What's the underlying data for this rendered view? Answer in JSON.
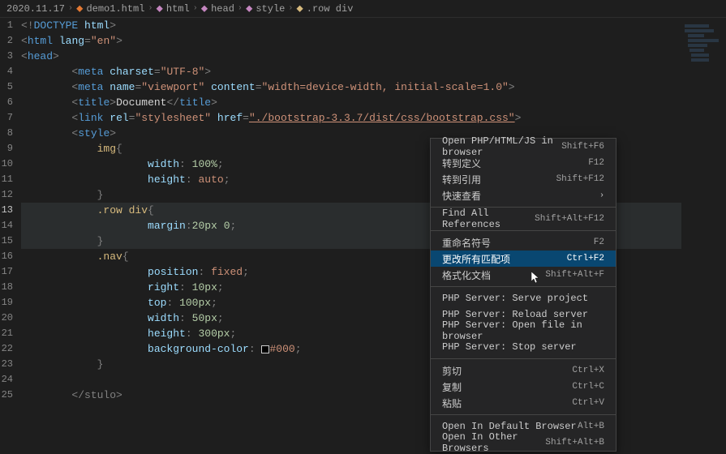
{
  "breadcrumb": {
    "root": "2020.11.17",
    "file": "demo1.html",
    "items": [
      "html",
      "head",
      "style",
      ".row div"
    ]
  },
  "lines": {
    "1": {
      "indent": 0,
      "type": "doctype",
      "pre": "<!",
      "tag": "DOCTYPE",
      "attr": " html",
      "post": ">"
    },
    "2": {
      "indent": 0,
      "type": "openattr",
      "tag": "html",
      "attrs": [
        {
          "n": "lang",
          "v": "\"en\""
        }
      ]
    },
    "3": {
      "indent": 0,
      "type": "open",
      "tag": "head"
    },
    "4": {
      "indent": 2,
      "type": "openattr",
      "tag": "meta",
      "attrs": [
        {
          "n": "charset",
          "v": "\"UTF-8\""
        }
      ]
    },
    "5": {
      "indent": 2,
      "type": "openattr",
      "tag": "meta",
      "attrs": [
        {
          "n": "name",
          "v": "\"viewport\""
        },
        {
          "n": "content",
          "v": "\"width=device-width, initial-scale=1.0\""
        }
      ]
    },
    "6": {
      "indent": 2,
      "type": "wrap",
      "tag": "title",
      "text": "Document"
    },
    "7": {
      "indent": 2,
      "type": "openattr",
      "tag": "link",
      "attrs": [
        {
          "n": "rel",
          "v": "\"stylesheet\""
        },
        {
          "n": "href",
          "v": "\"./bootstrap-3.3.7/dist/css/bootstrap.css\"",
          "u": true
        }
      ]
    },
    "8": {
      "indent": 2,
      "type": "open",
      "tag": "style"
    },
    "9": {
      "indent": 3,
      "type": "css-sel",
      "sel": "img",
      "brace": "{"
    },
    "10": {
      "indent": 5,
      "type": "css-prop",
      "prop": "width",
      "val": "100%"
    },
    "11": {
      "indent": 5,
      "type": "css-prop",
      "prop": "height",
      "val": "auto"
    },
    "12": {
      "indent": 3,
      "type": "css-close"
    },
    "13": {
      "indent": 3,
      "type": "css-sel",
      "sel": ".row div",
      "brace": "{",
      "hl": true
    },
    "14": {
      "indent": 5,
      "type": "css-prop",
      "prop": "margin",
      "val": "20px 0",
      "nospace": true,
      "hl": true
    },
    "15": {
      "indent": 3,
      "type": "css-close",
      "hl": true
    },
    "16": {
      "indent": 3,
      "type": "css-sel",
      "sel": ".nav",
      "brace": "{"
    },
    "17": {
      "indent": 5,
      "type": "css-prop",
      "prop": "position",
      "val": "fixed"
    },
    "18": {
      "indent": 5,
      "type": "css-prop",
      "prop": "right",
      "val": "10px"
    },
    "19": {
      "indent": 5,
      "type": "css-prop",
      "prop": "top",
      "val": "100px"
    },
    "20": {
      "indent": 5,
      "type": "css-prop",
      "prop": "width",
      "val": "50px"
    },
    "21": {
      "indent": 5,
      "type": "css-prop",
      "prop": "height",
      "val": "300px"
    },
    "22": {
      "indent": 5,
      "type": "css-prop",
      "prop": "background-color",
      "val": "#000",
      "swatch": true
    },
    "23": {
      "indent": 3,
      "type": "css-close"
    },
    "24": {
      "indent": 0,
      "type": "blank"
    },
    "25": {
      "indent": 2,
      "type": "close-partial",
      "text": "</stulo>"
    }
  },
  "menu": [
    {
      "type": "item",
      "label": "Open PHP/HTML/JS in browser",
      "shortcut": "Shift+F6"
    },
    {
      "type": "item",
      "label": "转到定义",
      "shortcut": "F12"
    },
    {
      "type": "item",
      "label": "转到引用",
      "shortcut": "Shift+F12"
    },
    {
      "type": "item",
      "label": "快速查看",
      "shortcut": "",
      "sub": true
    },
    {
      "type": "sep"
    },
    {
      "type": "item",
      "label": "Find All References",
      "shortcut": "Shift+Alt+F12"
    },
    {
      "type": "sep"
    },
    {
      "type": "item",
      "label": "重命名符号",
      "shortcut": "F2"
    },
    {
      "type": "item",
      "label": "更改所有匹配项",
      "shortcut": "Ctrl+F2",
      "selected": true
    },
    {
      "type": "item",
      "label": "格式化文档",
      "shortcut": "Shift+Alt+F"
    },
    {
      "type": "sep"
    },
    {
      "type": "item",
      "label": "PHP Server: Serve project",
      "shortcut": ""
    },
    {
      "type": "item",
      "label": "PHP Server: Reload server",
      "shortcut": ""
    },
    {
      "type": "item",
      "label": "PHP Server: Open file in browser",
      "shortcut": ""
    },
    {
      "type": "item",
      "label": "PHP Server: Stop server",
      "shortcut": ""
    },
    {
      "type": "sep"
    },
    {
      "type": "item",
      "label": "剪切",
      "shortcut": "Ctrl+X"
    },
    {
      "type": "item",
      "label": "复制",
      "shortcut": "Ctrl+C"
    },
    {
      "type": "item",
      "label": "粘贴",
      "shortcut": "Ctrl+V"
    },
    {
      "type": "sep"
    },
    {
      "type": "item",
      "label": "Open In Default Browser",
      "shortcut": "Alt+B"
    },
    {
      "type": "item",
      "label": "Open In Other Browsers",
      "shortcut": "Shift+Alt+B"
    }
  ]
}
